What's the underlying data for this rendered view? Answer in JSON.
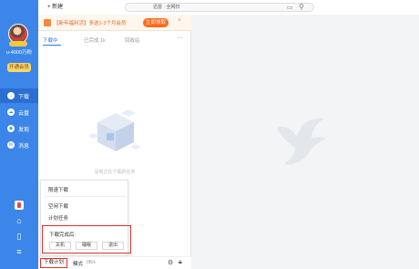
{
  "sidebar": {
    "username": "u-4000万粉",
    "open_vip": "开通会员",
    "items": [
      {
        "label": "下载",
        "icon": "download-icon"
      },
      {
        "label": "云盘",
        "icon": "cloud-icon"
      },
      {
        "label": "发现",
        "icon": "discover-icon"
      },
      {
        "label": "消息",
        "icon": "message-icon"
      }
    ]
  },
  "topbar": {
    "new_label": "+ 新建",
    "search_text": "迅雷 · 全网扫",
    "folder_icon": "folder-icon",
    "search_icon": "search-icon"
  },
  "banner": {
    "text": "【新年福利活】多送1-3个月会员",
    "button": "立即领取",
    "close": "×"
  },
  "tabs": [
    {
      "label": "下载中"
    },
    {
      "label": "已完成 1k"
    },
    {
      "label": "回收站"
    }
  ],
  "more": "···",
  "empty_text": "没有正在下载的任务",
  "menu": {
    "items": [
      "限速下载",
      "空闲下载",
      "计划任务"
    ],
    "after_download_title": "下载完成后:",
    "after_options": [
      "关机",
      "睡眠",
      "退出"
    ]
  },
  "bottombar": {
    "plan_label": "下载计划",
    "speed_label": "模式",
    "speed_value": "0B/s"
  },
  "colors": {
    "sidebar": "#3b86e8",
    "accent": "#2a78e4",
    "banner_button": "#ff6a1a",
    "highlight_box": "#e0312f"
  }
}
